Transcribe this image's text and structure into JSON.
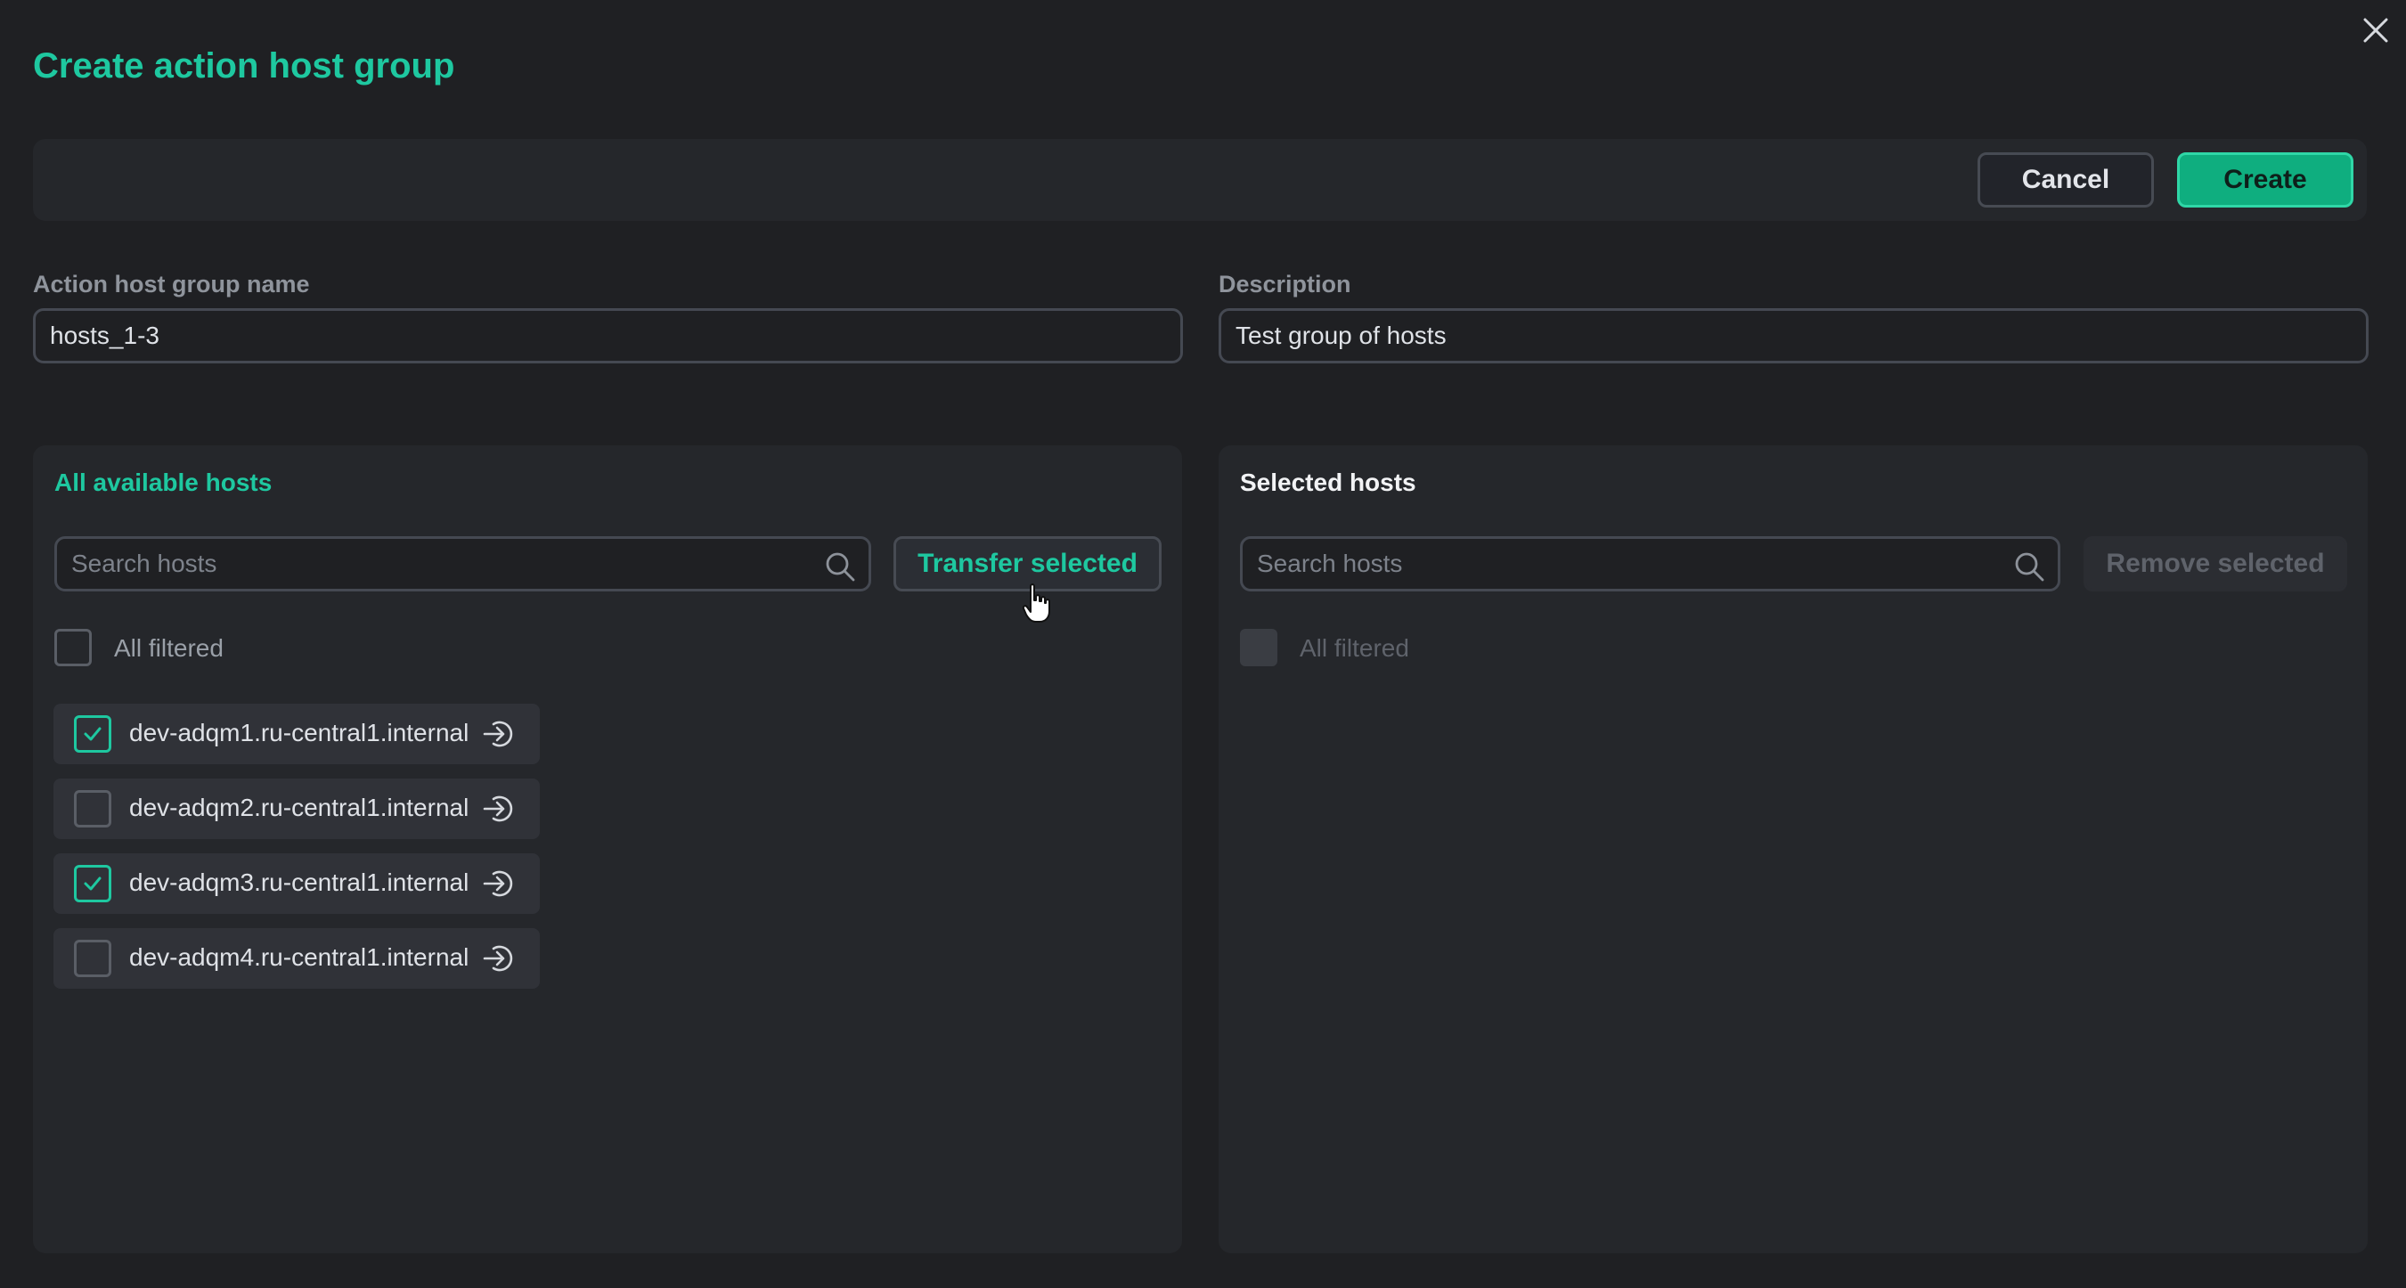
{
  "modal": {
    "title": "Create action host group"
  },
  "toolbar": {
    "cancel_label": "Cancel",
    "create_label": "Create"
  },
  "form": {
    "name_label": "Action host group name",
    "name_value": "hosts_1-3",
    "description_label": "Description",
    "description_value": "Test group of hosts"
  },
  "available": {
    "title": "All available hosts",
    "search_placeholder": "Search hosts",
    "transfer_label": "Transfer selected",
    "all_filtered_label": "All filtered",
    "hosts": [
      {
        "name": "dev-adqm1.ru-central1.internal",
        "checked": true
      },
      {
        "name": "dev-adqm2.ru-central1.internal",
        "checked": false
      },
      {
        "name": "dev-adqm3.ru-central1.internal",
        "checked": true
      },
      {
        "name": "dev-adqm4.ru-central1.internal",
        "checked": false
      }
    ]
  },
  "selected": {
    "title": "Selected hosts",
    "search_placeholder": "Search hosts",
    "remove_label": "Remove selected",
    "all_filtered_label": "All filtered"
  },
  "colors": {
    "accent": "#1ec8a0",
    "primary_button": "#0fae7f",
    "background": "#1f2023",
    "panel": "#25272b"
  },
  "icons": {
    "close": "close-icon",
    "search": "search-icon",
    "check": "check-icon",
    "transfer": "transfer-icon",
    "cursor": "hand-pointer-cursor"
  }
}
